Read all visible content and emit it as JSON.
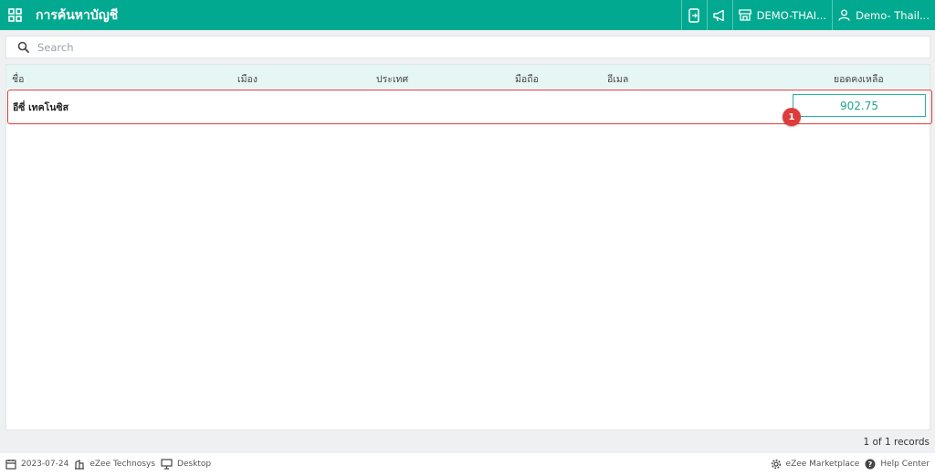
{
  "header": {
    "title": "การค้นหาบัญชี",
    "property": "DEMO-THAI...",
    "user": "Demo- Thail..."
  },
  "search": {
    "placeholder": "Search",
    "value": ""
  },
  "table": {
    "columns": [
      "ชื่อ",
      "เมือง",
      "ประเทศ",
      "มือถือ",
      "อีเมล",
      "ยอดคงเหลือ"
    ],
    "rows": [
      {
        "name": "อีซี่ เทคโนซิส",
        "balance": "902.75",
        "badge": "1"
      }
    ]
  },
  "records_text": "1 of 1 records",
  "footer": {
    "date": "2023-07-24",
    "company": "eZee Technosys",
    "device": "Desktop",
    "marketplace": "eZee Marketplace",
    "help": "Help Center"
  },
  "colors": {
    "primary": "#00a98f",
    "highlight": "#e03b3b",
    "header_bg": "#e6f6f4"
  }
}
